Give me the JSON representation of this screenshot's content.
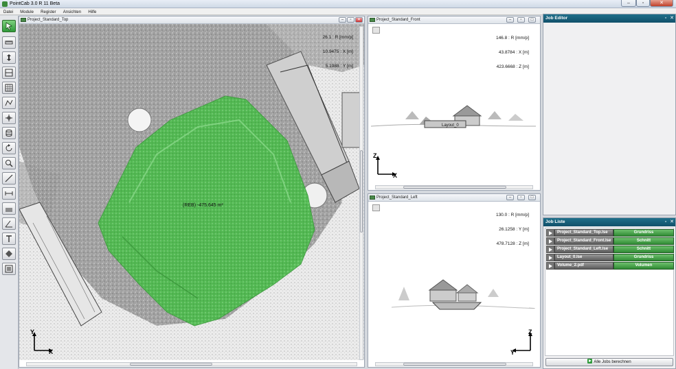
{
  "window": {
    "title": "PointCab 3.0 R 11 Beta"
  },
  "menu": [
    "Datei",
    "Module",
    "Register",
    "Ansichten",
    "Hilfe"
  ],
  "viewports": {
    "top": {
      "title": "Project_Standard_Top",
      "readout": [
        "26.1 : R [mm/p]",
        "10.9475 : X [m]",
        "5.1988 : Y [m]"
      ],
      "volume_label": "(REB) -475.645 m³",
      "axis_v": "Y",
      "axis_h": "X"
    },
    "front": {
      "title": "Project_Standard_Front",
      "readout": [
        "146.8 : R [mm/p]",
        "43.8784 : X [m]",
        "423.6668 : Z [m]"
      ],
      "layout_label": "Layout_0",
      "axis_v": "Z",
      "axis_h": "X"
    },
    "left": {
      "title": "Project_Standard_Left",
      "readout": [
        "130.0 : R [mm/p]",
        "26.1258 : Y [m]",
        "478.7128 : Z [m]"
      ],
      "axis_v": "Z",
      "axis_h": "Y"
    }
  },
  "job_editor": {
    "title": "Job Editor"
  },
  "job_list": {
    "title": "Job Liste",
    "jobs": [
      {
        "name": "Project_Standard_Top.lse",
        "type": "Grundriss"
      },
      {
        "name": "Project_Standard_Front.lse",
        "type": "Schnitt"
      },
      {
        "name": "Project_Standard_Left.lse",
        "type": "Schnitt"
      },
      {
        "name": "Layout_0.lse",
        "type": "Grundriss"
      },
      {
        "name": "Volume_2.pdf",
        "type": "Volumen"
      }
    ],
    "run_all_label": "Alle Jobs berechnen"
  },
  "colors": {
    "volume_fill": "#4dbb4d",
    "panel_header": "#11506a",
    "accent_green": "#2f9a3a"
  }
}
